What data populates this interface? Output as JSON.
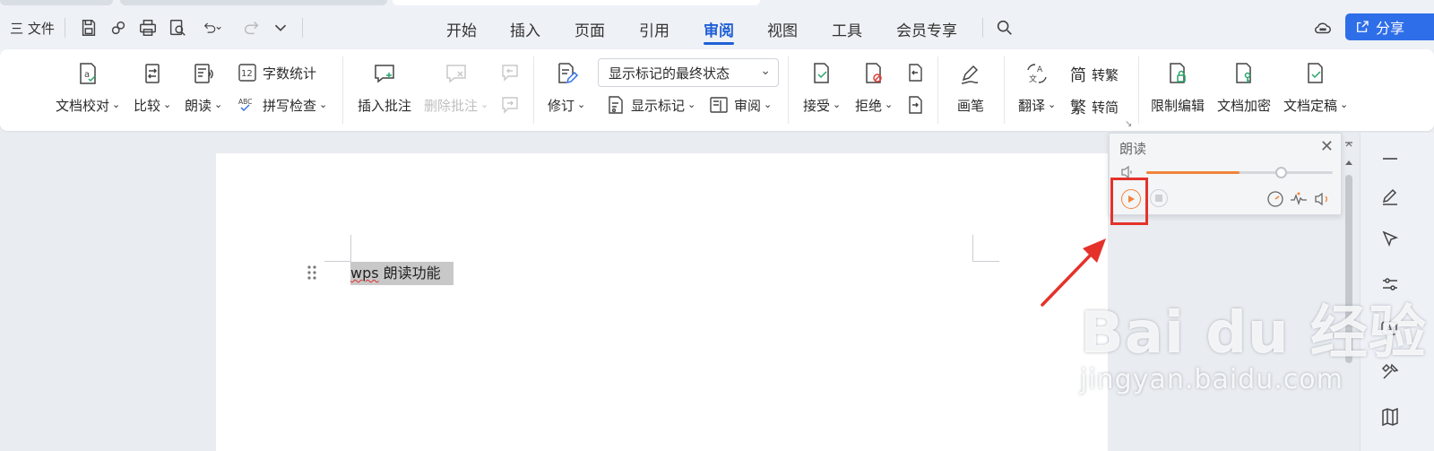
{
  "titlebar": {
    "file_menu": "三 文件",
    "tabs": [
      "开始",
      "插入",
      "页面",
      "引用",
      "审阅",
      "视图",
      "工具",
      "会员专享"
    ],
    "active_tab": "审阅",
    "share": "分享"
  },
  "ribbon": {
    "proofread": "文档校对",
    "compare": "比较",
    "read_aloud": "朗读",
    "word_count": "字数统计",
    "spell_check": "拼写检查",
    "insert_comment": "插入批注",
    "delete_comment": "删除批注",
    "revise": "修订",
    "markup_state": "显示标记的最终状态",
    "show_markup": "显示标记",
    "review": "审阅",
    "accept": "接受",
    "reject": "拒绝",
    "pen": "画笔",
    "translate": "翻译",
    "to_traditional": "转繁",
    "to_simplified": "转简",
    "restrict_edit": "限制编辑",
    "encrypt": "文档加密",
    "finalize": "文档定稿",
    "abc_badge": "ABC",
    "count_badge": "12"
  },
  "document": {
    "text_latin": "wps",
    "text_cjk": "朗读功能"
  },
  "read_panel": {
    "title": "朗读",
    "close": "✕",
    "volume_level": 0.5
  },
  "watermark": {
    "main": "Bai du 经验",
    "sub": "jingyan.baidu.com"
  },
  "colors": {
    "accent": "#1f5fd6",
    "share_bg": "#2f6ee9",
    "play_orange": "#f0843a",
    "highlight_red": "#e4322b"
  }
}
